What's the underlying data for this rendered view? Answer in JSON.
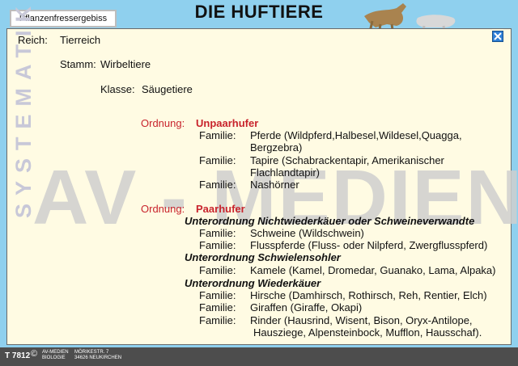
{
  "header": {
    "tab_label": "Pflanzenfressergebiss",
    "title": "DIE HUFTIERE"
  },
  "watermark": "AV - MEDIEN",
  "side_label": "SYSTEMATIK",
  "taxonomy": {
    "reich": {
      "label": "Reich:",
      "value": "Tierreich"
    },
    "stamm": {
      "label": "Stamm:",
      "value": "Wirbeltiere"
    },
    "klasse": {
      "label": "Klasse:",
      "value": "Säugetiere"
    },
    "ordnung1": {
      "label": "Ordnung:",
      "value": "Unpaarhufer"
    },
    "ordnung1_families": [
      {
        "label": "Familie:",
        "value": "Pferde (Wildpferd,Halbesel,Wildesel,Quagga,",
        "cont": "Bergzebra)"
      },
      {
        "label": "Familie:",
        "value": "Tapire (Schabrackentapir, Amerikanischer",
        "cont": "Flachlandtapir)"
      },
      {
        "label": "Familie:",
        "value": "Nashörner"
      }
    ],
    "ordnung2": {
      "label": "Ordnung:",
      "value": "Paarhufer"
    },
    "unterordnungen": [
      {
        "title": "Unterordnung Nichtwiederkäuer oder Schweineverwandte",
        "families": [
          {
            "label": "Familie:",
            "value": "Schweine (Wildschwein)"
          },
          {
            "label": "Familie:",
            "value": "Flusspferde (Fluss- oder Nilpferd, Zwergflusspferd)"
          }
        ]
      },
      {
        "title": "Unterordnung Schwielensohler",
        "families": [
          {
            "label": "Familie:",
            "value": "Kamele (Kamel, Dromedar, Guanako, Lama, Alpaka)"
          }
        ]
      },
      {
        "title": "Unterordnung Wiederkäuer",
        "families": [
          {
            "label": "Familie:",
            "value": "Hirsche (Damhirsch, Rothirsch, Reh, Rentier, Elch)"
          },
          {
            "label": "Familie:",
            "value": "Giraffen (Giraffe, Okapi)"
          },
          {
            "label": "Familie:",
            "value": "Rinder (Hausrind, Wisent, Bison, Oryx-Antilope,",
            "cont": "Hausziege, Alpensteinbock, Mufflon, Hausschaf)."
          }
        ]
      }
    ]
  },
  "footer": {
    "code": "T 7812",
    "copyright": "©",
    "publisher_line1": "AV-MEDIEN",
    "publisher_line2": "BIOLOGIE",
    "address_line1": "MÖRIKESTR. 7",
    "address_line2": "34626 NEUKIRCHEN"
  },
  "icons": {
    "close": "close-icon"
  },
  "colors": {
    "background": "#8fd0ee",
    "panel": "#fffbe3",
    "accent_red": "#c8232c",
    "close_blue": "#2f7fd6"
  }
}
